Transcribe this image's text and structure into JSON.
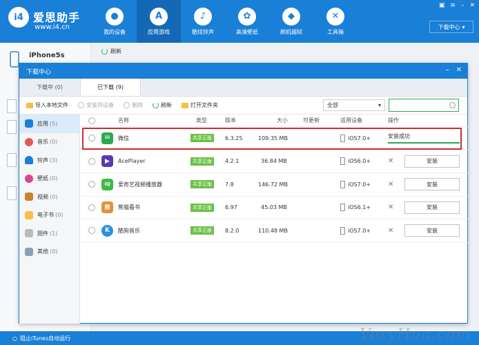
{
  "app": {
    "logo_text": "i4",
    "brand_name": "爱思助手",
    "brand_url": "www.i4.cn",
    "nav": [
      {
        "label": "我的设备",
        "icon": "apple-icon",
        "glyph": ""
      },
      {
        "label": "应用游戏",
        "icon": "app-store-icon",
        "glyph": "A"
      },
      {
        "label": "酷炫铃声",
        "icon": "bell-icon",
        "glyph": "♪"
      },
      {
        "label": "高清壁纸",
        "icon": "wallpaper-icon",
        "glyph": "✿"
      },
      {
        "label": "刷机越狱",
        "icon": "dropbox-icon",
        "glyph": "◆"
      },
      {
        "label": "工具箱",
        "icon": "tools-icon",
        "glyph": "✕"
      }
    ],
    "download_center_btn": "下载中心",
    "device_name": "iPhone5s",
    "bg_refresh": "刷新",
    "itunes_link": "阻止iTunes自动运行",
    "watermark": "VeryHua.com"
  },
  "dialog": {
    "title": "下载中心",
    "tabs": [
      "下载中 (0)",
      "已下载 (9)"
    ],
    "toolbar": {
      "import": "导入本地文件",
      "install_to_device": "安装到设备",
      "delete": "删除",
      "refresh": "刷新",
      "open_folder": "打开文件夹"
    },
    "filter_value": "全部",
    "search_placeholder": "",
    "sidebar": [
      {
        "label": "应用",
        "count": "(5)",
        "color": "#1a7fd6"
      },
      {
        "label": "音乐",
        "count": "(0)",
        "color": "#e05a5a"
      },
      {
        "label": "铃声",
        "count": "(3)",
        "color": "#1a7fd6"
      },
      {
        "label": "壁纸",
        "count": "(0)",
        "color": "#d64a8a"
      },
      {
        "label": "视频",
        "count": "(0)",
        "color": "#c8842c"
      },
      {
        "label": "电子书",
        "count": "(0)",
        "color": "#f2c04b"
      },
      {
        "label": "固件",
        "count": "(1)",
        "color": "#bbbbbb"
      },
      {
        "label": "其他",
        "count": "(0)",
        "color": "#8aa0b8"
      }
    ],
    "columns": {
      "name": "名称",
      "type": "类型",
      "version": "版本",
      "size": "大小",
      "updatable": "可更新",
      "device": "适用设备",
      "action": "操作"
    },
    "rows": [
      {
        "name": "微信",
        "badge": "共享正版",
        "version": "6.3.25",
        "size": "109.35 MB",
        "device": "iOS7.0+",
        "status": "安装成功",
        "icon_color": "#2da94f",
        "icon_glyph": "✉",
        "progress": 1.0
      },
      {
        "name": "AcePlayer",
        "badge": "共享正版",
        "version": "4.2.1",
        "size": "36.84 MB",
        "device": "iOS6.0+",
        "action": "安装",
        "icon_color": "#5a3bb5",
        "icon_glyph": "▶"
      },
      {
        "name": "爱奇艺视频播放器",
        "badge": "共享正版",
        "version": "7.8",
        "size": "146.72 MB",
        "device": "iOS7.0+",
        "action": "安装",
        "icon_color": "#3cba44",
        "icon_glyph": "iQ"
      },
      {
        "name": "熊猫看书",
        "badge": "共享正版",
        "version": "6.97",
        "size": "45.03 MB",
        "device": "iOS6.1+",
        "action": "安装",
        "icon_color": "#e0923a",
        "icon_glyph": "熊"
      },
      {
        "name": "酷狗音乐",
        "badge": "共享正版",
        "version": "8.2.0",
        "size": "110.48 MB",
        "device": "iOS7.0+",
        "action": "安装",
        "icon_color": "#2a8fe0",
        "icon_glyph": "K"
      }
    ]
  }
}
